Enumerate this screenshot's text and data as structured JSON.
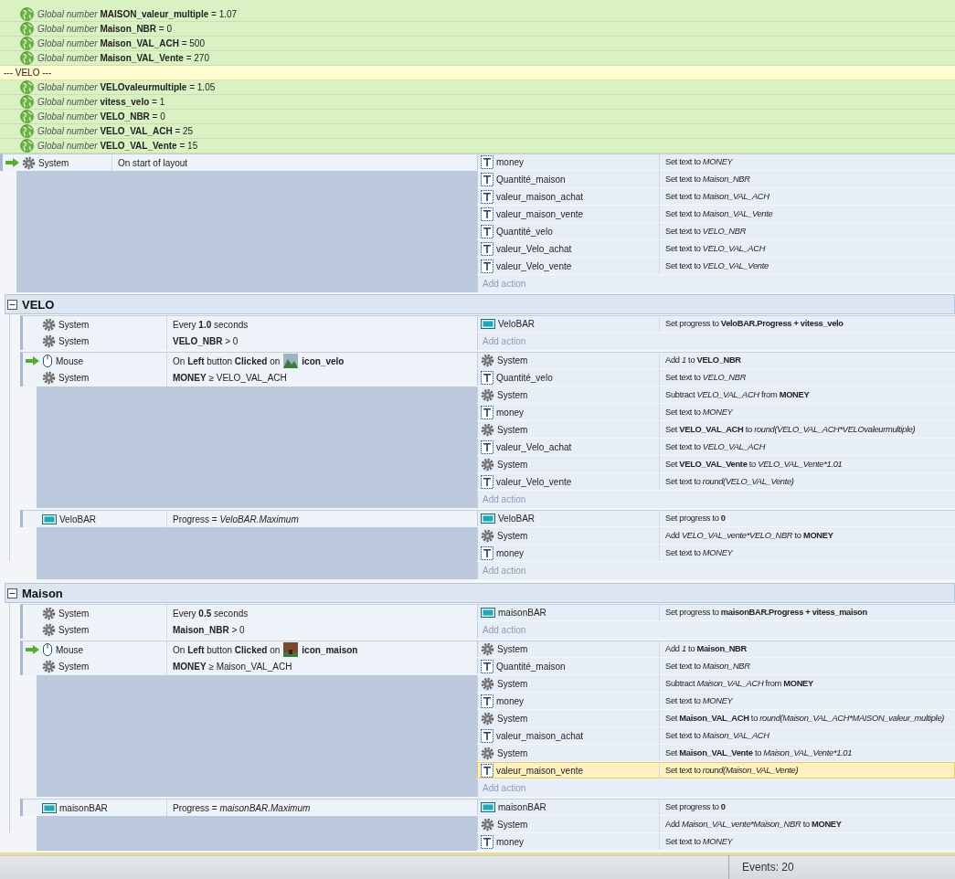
{
  "globals": [
    {
      "kind": "variable",
      "parts": [
        {
          "i": "Global number "
        },
        {
          "b": "MAISON_valeur_multiple"
        },
        {
          "t": " = 1.07"
        }
      ]
    },
    {
      "kind": "variable",
      "parts": [
        {
          "i": "Global number "
        },
        {
          "b": "Maison_NBR"
        },
        {
          "t": " = 0"
        }
      ]
    },
    {
      "kind": "variable",
      "parts": [
        {
          "i": "Global number "
        },
        {
          "b": "Maison_VAL_ACH"
        },
        {
          "t": " = 500"
        }
      ]
    },
    {
      "kind": "variable",
      "parts": [
        {
          "i": "Global number "
        },
        {
          "b": "Maison_VAL_Vente"
        },
        {
          "t": " = 270"
        }
      ]
    },
    {
      "kind": "comment",
      "text": "--- VELO ---"
    },
    {
      "kind": "variable",
      "parts": [
        {
          "i": "Global number "
        },
        {
          "b": "VELOvaleurmultiple"
        },
        {
          "t": " = 1.05"
        }
      ]
    },
    {
      "kind": "variable",
      "parts": [
        {
          "i": "Global number "
        },
        {
          "b": "vitess_velo"
        },
        {
          "t": " = 1"
        }
      ]
    },
    {
      "kind": "variable",
      "parts": [
        {
          "i": "Global number "
        },
        {
          "b": "VELO_NBR"
        },
        {
          "t": " = 0"
        }
      ]
    },
    {
      "kind": "variable",
      "parts": [
        {
          "i": "Global number "
        },
        {
          "b": "VELO_VAL_ACH"
        },
        {
          "t": " = 25"
        }
      ]
    },
    {
      "kind": "variable",
      "parts": [
        {
          "i": "Global number "
        },
        {
          "b": "VELO_VAL_Vente"
        },
        {
          "t": " = 15"
        }
      ]
    }
  ],
  "events": [
    {
      "kind": "event",
      "conditions": [
        {
          "kind": "system",
          "object": "System",
          "trigger": true,
          "parts": [
            {
              "t": "On start of layout"
            }
          ]
        }
      ],
      "actions": [
        {
          "kind": "text",
          "object": "money",
          "selected": false,
          "parts": [
            {
              "t": "Set text to "
            },
            {
              "i": "MONEY"
            }
          ]
        },
        {
          "kind": "text",
          "object": "Quantité_maison",
          "selected": false,
          "parts": [
            {
              "t": "Set text to "
            },
            {
              "i": "Maison_NBR"
            }
          ]
        },
        {
          "kind": "text",
          "object": "valeur_maison_achat",
          "selected": false,
          "parts": [
            {
              "t": "Set text to "
            },
            {
              "i": "Maison_VAL_ACH"
            }
          ]
        },
        {
          "kind": "text",
          "object": "valeur_maison_vente",
          "selected": false,
          "parts": [
            {
              "t": "Set text to "
            },
            {
              "i": "Maison_VAL_Vente"
            }
          ]
        },
        {
          "kind": "text",
          "object": "Quantité_velo",
          "selected": false,
          "parts": [
            {
              "t": "Set text to "
            },
            {
              "i": "VELO_NBR"
            }
          ]
        },
        {
          "kind": "text",
          "object": "valeur_Velo_achat",
          "selected": false,
          "parts": [
            {
              "t": "Set text to "
            },
            {
              "i": "VELO_VAL_ACH"
            }
          ]
        },
        {
          "kind": "text",
          "object": "valeur_Velo_vente",
          "selected": false,
          "parts": [
            {
              "t": "Set text to "
            },
            {
              "i": "VELO_VAL_Vente"
            }
          ]
        }
      ],
      "add_action": "Add action"
    },
    {
      "kind": "group",
      "title": "VELO",
      "expanded": true,
      "events": [
        {
          "kind": "event",
          "conditions": [
            {
              "kind": "system",
              "object": "System",
              "trigger": false,
              "parts": [
                {
                  "t": "Every "
                },
                {
                  "b": "1.0"
                },
                {
                  "t": " seconds"
                }
              ]
            },
            {
              "kind": "system",
              "object": "System",
              "trigger": false,
              "parts": [
                {
                  "b": "VELO_NBR"
                },
                {
                  "t": " > 0"
                }
              ]
            }
          ],
          "actions": [
            {
              "kind": "progressbar",
              "object": "VeloBAR",
              "selected": false,
              "parts": [
                {
                  "t": "Set progress to "
                },
                {
                  "b": "VeloBAR.Progress + vitess_velo"
                }
              ]
            }
          ],
          "add_action": "Add action"
        },
        {
          "kind": "event",
          "conditions": [
            {
              "kind": "mouse",
              "object": "Mouse",
              "trigger": true,
              "parts": [
                {
                  "t": "On "
                },
                {
                  "b": "Left"
                },
                {
                  "t": " button "
                },
                {
                  "b": "Clicked"
                },
                {
                  "t": " on "
                }
              ],
              "target": {
                "kind": "landscape",
                "name": "icon_velo"
              }
            },
            {
              "kind": "system",
              "object": "System",
              "trigger": false,
              "parts": [
                {
                  "b": "MONEY"
                },
                {
                  "t": " ≥ VELO_VAL_ACH"
                }
              ]
            }
          ],
          "actions": [
            {
              "kind": "system",
              "object": "System",
              "selected": false,
              "parts": [
                {
                  "t": "Add "
                },
                {
                  "i": "1"
                },
                {
                  "t": " to "
                },
                {
                  "b": "VELO_NBR"
                }
              ]
            },
            {
              "kind": "text",
              "object": "Quantité_velo",
              "selected": false,
              "parts": [
                {
                  "t": "Set text to "
                },
                {
                  "i": "VELO_NBR"
                }
              ]
            },
            {
              "kind": "system",
              "object": "System",
              "selected": false,
              "parts": [
                {
                  "t": "Subtract "
                },
                {
                  "i": "VELO_VAL_ACH"
                },
                {
                  "t": " from "
                },
                {
                  "b": "MONEY"
                }
              ]
            },
            {
              "kind": "text",
              "object": "money",
              "selected": false,
              "parts": [
                {
                  "t": "Set text to "
                },
                {
                  "i": "MONEY"
                }
              ]
            },
            {
              "kind": "system",
              "object": "System",
              "selected": false,
              "parts": [
                {
                  "t": "Set "
                },
                {
                  "b": "VELO_VAL_ACH"
                },
                {
                  "t": " to "
                },
                {
                  "i": "round(VELO_VAL_ACH*VELOvaleurmultiple)"
                }
              ]
            },
            {
              "kind": "text",
              "object": "valeur_Velo_achat",
              "selected": false,
              "parts": [
                {
                  "t": "Set text to "
                },
                {
                  "i": "VELO_VAL_ACH"
                }
              ]
            },
            {
              "kind": "system",
              "object": "System",
              "selected": false,
              "parts": [
                {
                  "t": "Set "
                },
                {
                  "b": "VELO_VAL_Vente"
                },
                {
                  "t": " to "
                },
                {
                  "i": "VELO_VAL_Vente*1.01"
                }
              ]
            },
            {
              "kind": "text",
              "object": "valeur_Velo_vente",
              "selected": false,
              "parts": [
                {
                  "t": "Set text to "
                },
                {
                  "i": "round(VELO_VAL_Vente)"
                }
              ]
            }
          ],
          "add_action": "Add action"
        },
        {
          "kind": "event",
          "conditions": [
            {
              "kind": "progressbar",
              "object": "VeloBAR",
              "trigger": false,
              "parts": [
                {
                  "t": "Progress = "
                },
                {
                  "i": "VeloBAR.Maximum"
                }
              ]
            }
          ],
          "actions": [
            {
              "kind": "progressbar",
              "object": "VeloBAR",
              "selected": false,
              "parts": [
                {
                  "t": "Set progress to "
                },
                {
                  "b": "0"
                }
              ]
            },
            {
              "kind": "system",
              "object": "System",
              "selected": false,
              "parts": [
                {
                  "t": "Add "
                },
                {
                  "i": "VELO_VAL_vente*VELO_NBR"
                },
                {
                  "t": "  to "
                },
                {
                  "b": "MONEY"
                }
              ]
            },
            {
              "kind": "text",
              "object": "money",
              "selected": false,
              "parts": [
                {
                  "t": "Set text to "
                },
                {
                  "i": "MONEY"
                }
              ]
            }
          ],
          "add_action": "Add action"
        }
      ]
    },
    {
      "kind": "group",
      "title": "Maison",
      "expanded": true,
      "events": [
        {
          "kind": "event",
          "conditions": [
            {
              "kind": "system",
              "object": "System",
              "trigger": false,
              "parts": [
                {
                  "t": "Every "
                },
                {
                  "b": "0.5"
                },
                {
                  "t": " seconds"
                }
              ]
            },
            {
              "kind": "system",
              "object": "System",
              "trigger": false,
              "parts": [
                {
                  "b": "Maison_NBR"
                },
                {
                  "t": " > 0"
                }
              ]
            }
          ],
          "actions": [
            {
              "kind": "progressbar",
              "object": "maisonBAR",
              "selected": false,
              "parts": [
                {
                  "t": "Set progress to "
                },
                {
                  "b": "maisonBAR.Progress + vitess_maison"
                }
              ]
            }
          ],
          "add_action": "Add action"
        },
        {
          "kind": "event",
          "conditions": [
            {
              "kind": "mouse",
              "object": "Mouse",
              "trigger": true,
              "parts": [
                {
                  "t": "On "
                },
                {
                  "b": "Left"
                },
                {
                  "t": " button "
                },
                {
                  "b": "Clicked"
                },
                {
                  "t": " on "
                }
              ],
              "target": {
                "kind": "house",
                "name": "icon_maison"
              }
            },
            {
              "kind": "system",
              "object": "System",
              "trigger": false,
              "parts": [
                {
                  "b": "MONEY"
                },
                {
                  "t": " ≥ Maison_VAL_ACH"
                }
              ]
            }
          ],
          "actions": [
            {
              "kind": "system",
              "object": "System",
              "selected": false,
              "parts": [
                {
                  "t": "Add "
                },
                {
                  "i": "1"
                },
                {
                  "t": " to "
                },
                {
                  "b": "Maison_NBR"
                }
              ]
            },
            {
              "kind": "text",
              "object": "Quantité_maison",
              "selected": false,
              "parts": [
                {
                  "t": "Set text to "
                },
                {
                  "i": "Maison_NBR"
                }
              ]
            },
            {
              "kind": "system",
              "object": "System",
              "selected": false,
              "parts": [
                {
                  "t": "Subtract "
                },
                {
                  "i": "Maison_VAL_ACH"
                },
                {
                  "t": " from "
                },
                {
                  "b": "MONEY"
                }
              ]
            },
            {
              "kind": "text",
              "object": "money",
              "selected": false,
              "parts": [
                {
                  "t": "Set text to "
                },
                {
                  "i": "MONEY"
                }
              ]
            },
            {
              "kind": "system",
              "object": "System",
              "selected": false,
              "parts": [
                {
                  "t": "Set "
                },
                {
                  "b": "Maison_VAL_ACH"
                },
                {
                  "t": " to "
                },
                {
                  "i": "round(Maison_VAL_ACH*MAISON_valeur_multiple)"
                }
              ]
            },
            {
              "kind": "text",
              "object": "valeur_maison_achat",
              "selected": false,
              "parts": [
                {
                  "t": "Set text to "
                },
                {
                  "i": "Maison_VAL_ACH"
                }
              ]
            },
            {
              "kind": "system",
              "object": "System",
              "selected": false,
              "parts": [
                {
                  "t": "Set "
                },
                {
                  "b": "Maison_VAL_Vente"
                },
                {
                  "t": " to "
                },
                {
                  "i": "Maison_VAL_Vente*1.01"
                }
              ]
            },
            {
              "kind": "text",
              "object": "valeur_maison_vente",
              "selected": true,
              "parts": [
                {
                  "t": "Set text to "
                },
                {
                  "i": "round(Maison_VAL_Vente)"
                }
              ]
            }
          ],
          "add_action": "Add action"
        },
        {
          "kind": "event",
          "conditions": [
            {
              "kind": "progressbar",
              "object": "maisonBAR",
              "trigger": false,
              "parts": [
                {
                  "t": "Progress = "
                },
                {
                  "i": "maisonBAR.Maximum"
                }
              ]
            }
          ],
          "actions": [
            {
              "kind": "progressbar",
              "object": "maisonBAR",
              "selected": false,
              "parts": [
                {
                  "t": "Set progress to "
                },
                {
                  "b": "0"
                }
              ]
            },
            {
              "kind": "system",
              "object": "System",
              "selected": false,
              "parts": [
                {
                  "t": "Add "
                },
                {
                  "i": "Maison_VAL_vente*Maison_NBR"
                },
                {
                  "t": "  to "
                },
                {
                  "b": "MONEY"
                }
              ]
            },
            {
              "kind": "text",
              "object": "money",
              "selected": false,
              "parts": [
                {
                  "t": "Set text to "
                },
                {
                  "i": "MONEY"
                }
              ]
            }
          ]
        }
      ]
    }
  ],
  "status_bar": {
    "events_count": "Events: 20"
  }
}
